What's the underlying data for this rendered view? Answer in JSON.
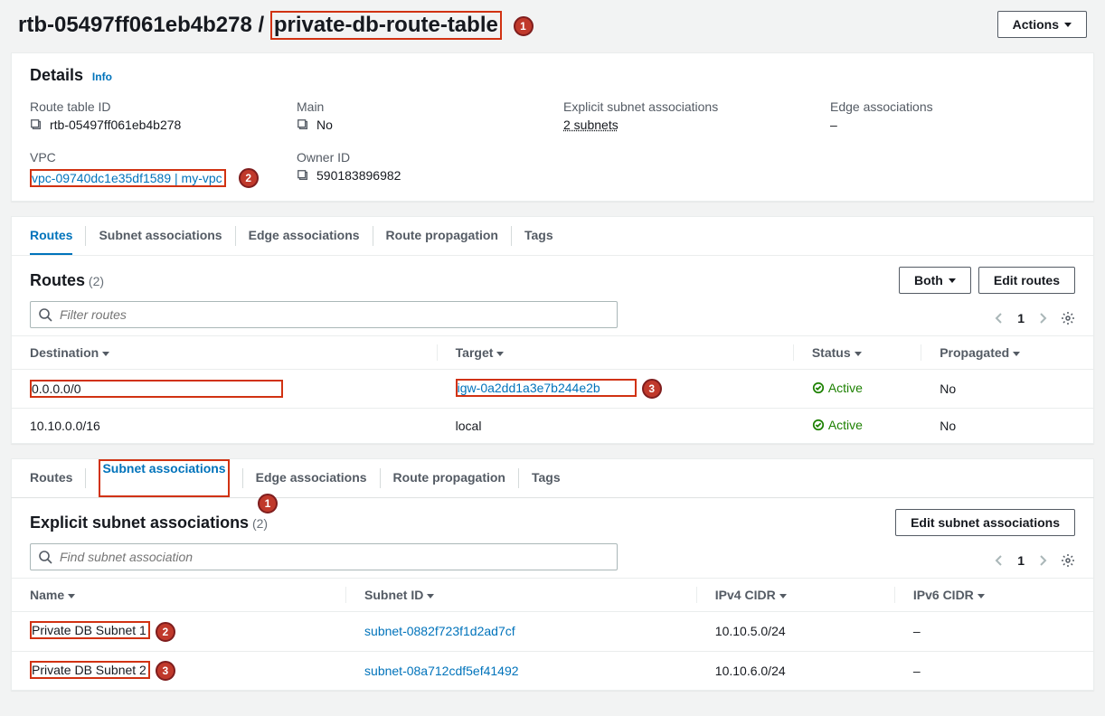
{
  "header": {
    "prefix": "rtb-05497ff061eb4b278 / ",
    "name": "private-db-route-table",
    "actions_label": "Actions"
  },
  "details": {
    "title": "Details",
    "info": "Info",
    "fields": {
      "route_table_id_label": "Route table ID",
      "route_table_id": "rtb-05497ff061eb4b278",
      "main_label": "Main",
      "main": "No",
      "explicit_label": "Explicit subnet associations",
      "explicit": "2 subnets",
      "edge_label": "Edge associations",
      "edge": "–",
      "vpc_label": "VPC",
      "vpc": "vpc-09740dc1e35df1589 | my-vpc",
      "owner_label": "Owner ID",
      "owner": "590183896982"
    }
  },
  "tabs1": [
    "Routes",
    "Subnet associations",
    "Edge associations",
    "Route propagation",
    "Tags"
  ],
  "routes": {
    "title": "Routes",
    "count": "(2)",
    "filter_placeholder": "Filter routes",
    "both_label": "Both",
    "edit_label": "Edit routes",
    "page": "1",
    "columns": [
      "Destination",
      "Target",
      "Status",
      "Propagated"
    ],
    "rows": [
      {
        "dest": "0.0.0.0/0",
        "target": "igw-0a2dd1a3e7b244e2b",
        "target_link": true,
        "status": "Active",
        "propagated": "No"
      },
      {
        "dest": "10.10.0.0/16",
        "target": "local",
        "target_link": false,
        "status": "Active",
        "propagated": "No"
      }
    ]
  },
  "tabs2": [
    "Routes",
    "Subnet associations",
    "Edge associations",
    "Route propagation",
    "Tags"
  ],
  "subnets": {
    "title": "Explicit subnet associations",
    "count": "(2)",
    "edit_label": "Edit subnet associations",
    "filter_placeholder": "Find subnet association",
    "page": "1",
    "columns": [
      "Name",
      "Subnet ID",
      "IPv4 CIDR",
      "IPv6 CIDR"
    ],
    "rows": [
      {
        "name": "Private DB Subnet 1",
        "subnet_id": "subnet-0882f723f1d2ad7cf",
        "ipv4": "10.10.5.0/24",
        "ipv6": "–"
      },
      {
        "name": "Private DB Subnet 2",
        "subnet_id": "subnet-08a712cdf5ef41492",
        "ipv4": "10.10.6.0/24",
        "ipv6": "–"
      }
    ]
  },
  "annotations": {
    "a1": "1",
    "a2": "2",
    "a3": "3"
  }
}
